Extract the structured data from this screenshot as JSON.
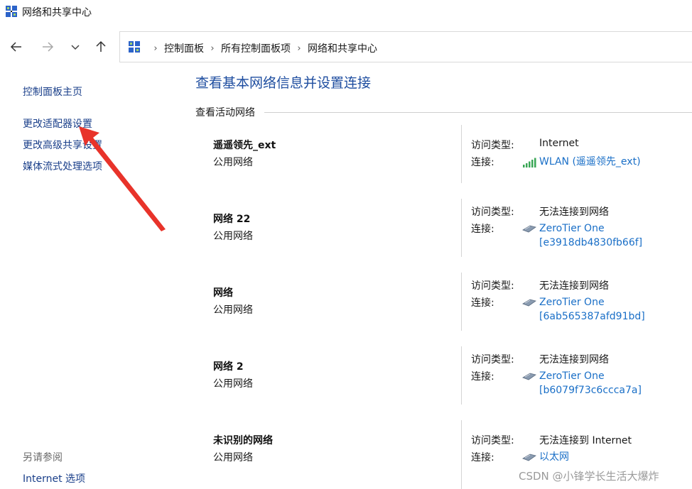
{
  "window": {
    "title": "网络和共享中心"
  },
  "breadcrumb": [
    "控制面板",
    "所有控制面板项",
    "网络和共享中心"
  ],
  "sidebar": {
    "links": [
      "控制面板主页",
      "更改适配器设置",
      "更改高级共享设置",
      "媒体流式处理选项"
    ],
    "see_also_heading": "另请参阅",
    "see_also_links": [
      "Internet 选项"
    ]
  },
  "main": {
    "title": "查看基本网络信息并设置连接",
    "section_label": "查看活动网络",
    "access_type_label": "访问类型:",
    "connection_label": "连接:",
    "networks": [
      {
        "name": "遥遥领先_ext",
        "category": "公用网络",
        "access_type": "Internet",
        "connection_icon": "wifi-signal-icon",
        "connection_lines": [
          "WLAN (遥遥领先_ext)"
        ]
      },
      {
        "name": "网络 22",
        "category": "公用网络",
        "access_type": "无法连接到网络",
        "connection_icon": "ethernet-adapter-icon",
        "connection_lines": [
          "ZeroTier One",
          "[e3918db4830fb66f]"
        ]
      },
      {
        "name": "网络",
        "category": "公用网络",
        "access_type": "无法连接到网络",
        "connection_icon": "ethernet-adapter-icon",
        "connection_lines": [
          "ZeroTier One",
          "[6ab565387afd91bd]"
        ]
      },
      {
        "name": "网络 2",
        "category": "公用网络",
        "access_type": "无法连接到网络",
        "connection_icon": "ethernet-adapter-icon",
        "connection_lines": [
          "ZeroTier One",
          "[b6079f73c6ccca7a]"
        ]
      },
      {
        "name": "未识别的网络",
        "category": "公用网络",
        "access_type": "无法连接到 Internet",
        "connection_icon": "ethernet-adapter-icon",
        "connection_lines": [
          "以太网"
        ]
      }
    ]
  },
  "watermark": "CSDN @小锋学长生活大爆炸",
  "colors": {
    "title_blue": "#1f4ea0",
    "link_blue": "#1a6fc7",
    "side_link": "#1a3f8a",
    "annotation_arrow": "#e8332a"
  }
}
